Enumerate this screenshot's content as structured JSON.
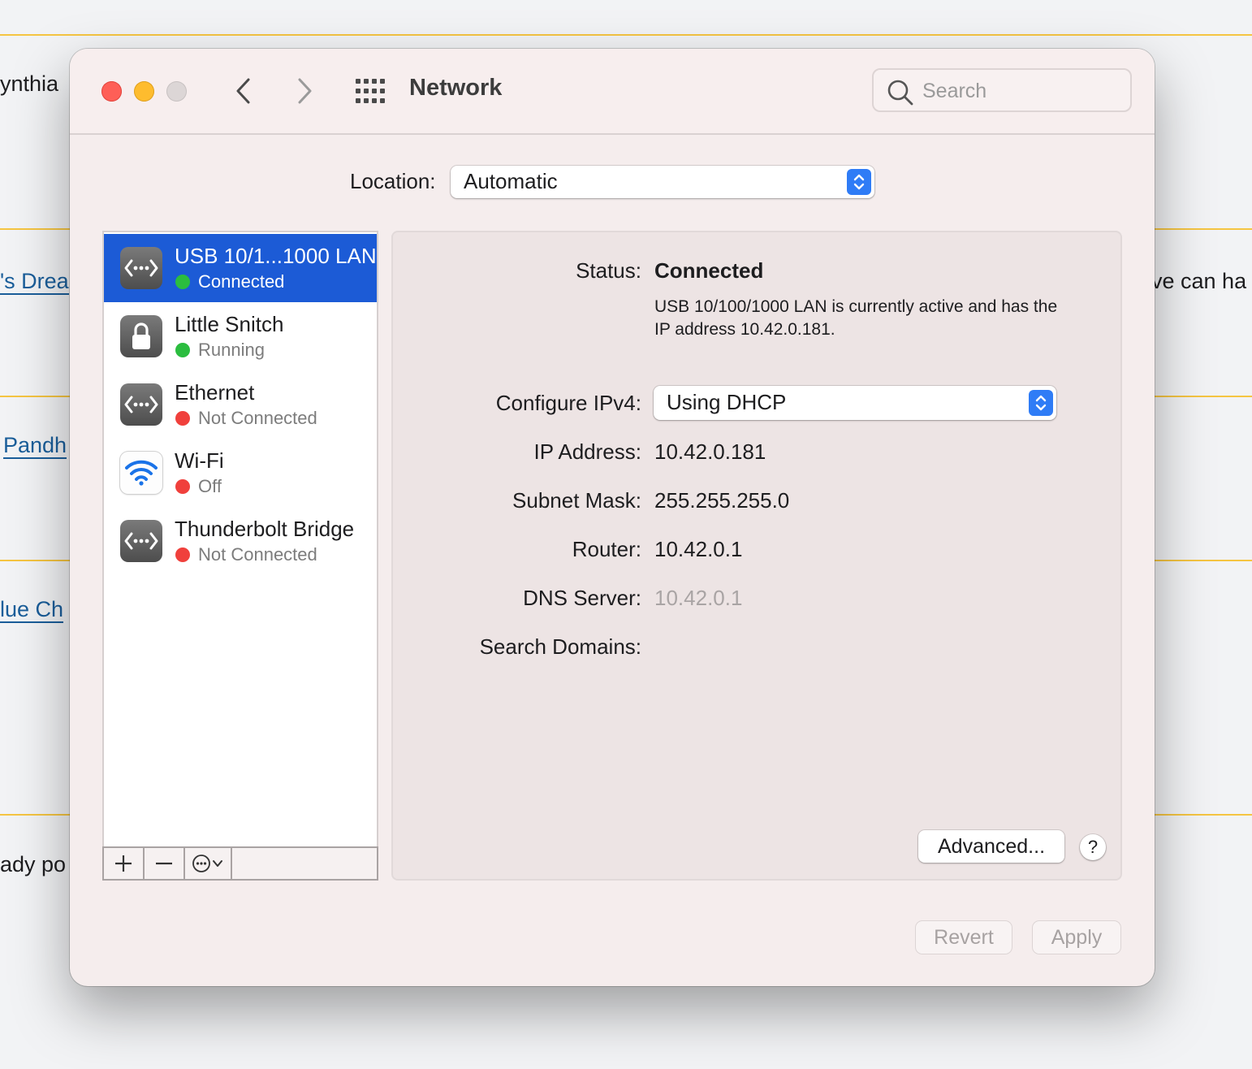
{
  "background": {
    "fragments": [
      "ynthia",
      "'s Drea",
      "Pandh",
      "lue Ch",
      "ady po",
      "ve can ha"
    ]
  },
  "window": {
    "title": "Network",
    "search_placeholder": "Search",
    "location_label": "Location:",
    "location_value": "Automatic"
  },
  "services": [
    {
      "name": "USB 10/1...1000 LAN",
      "status": "Connected",
      "status_color": "#2bbd3f",
      "icon": "ethernet-icon",
      "selected": true
    },
    {
      "name": "Little Snitch",
      "status": "Running",
      "status_color": "#2bbd3f",
      "icon": "lock-icon",
      "selected": false
    },
    {
      "name": "Ethernet",
      "status": "Not Connected",
      "status_color": "#f0403c",
      "icon": "ethernet-icon",
      "selected": false
    },
    {
      "name": "Wi-Fi",
      "status": "Off",
      "status_color": "#f0403c",
      "icon": "wifi-icon",
      "selected": false
    },
    {
      "name": "Thunderbolt Bridge",
      "status": "Not Connected",
      "status_color": "#f0403c",
      "icon": "ethernet-icon",
      "selected": false
    }
  ],
  "toolbar": {
    "add": "+",
    "remove": "—"
  },
  "detail": {
    "status_label": "Status:",
    "status_value": "Connected",
    "status_description": "USB 10/100/1000 LAN is currently active and has the IP address 10.42.0.181.",
    "configure_label": "Configure IPv4:",
    "configure_value": "Using DHCP",
    "ip_label": "IP Address:",
    "ip_value": "10.42.0.181",
    "subnet_label": "Subnet Mask:",
    "subnet_value": "255.255.255.0",
    "router_label": "Router:",
    "router_value": "10.42.0.1",
    "dns_label": "DNS Server:",
    "dns_value": "10.42.0.1",
    "search_domains_label": "Search Domains:",
    "advanced_label": "Advanced...",
    "help_label": "?"
  },
  "footer": {
    "revert": "Revert",
    "apply": "Apply"
  },
  "colors": {
    "accent": "#1c5bd6",
    "connected": "#2bbd3f",
    "disconnected": "#f0403c"
  }
}
